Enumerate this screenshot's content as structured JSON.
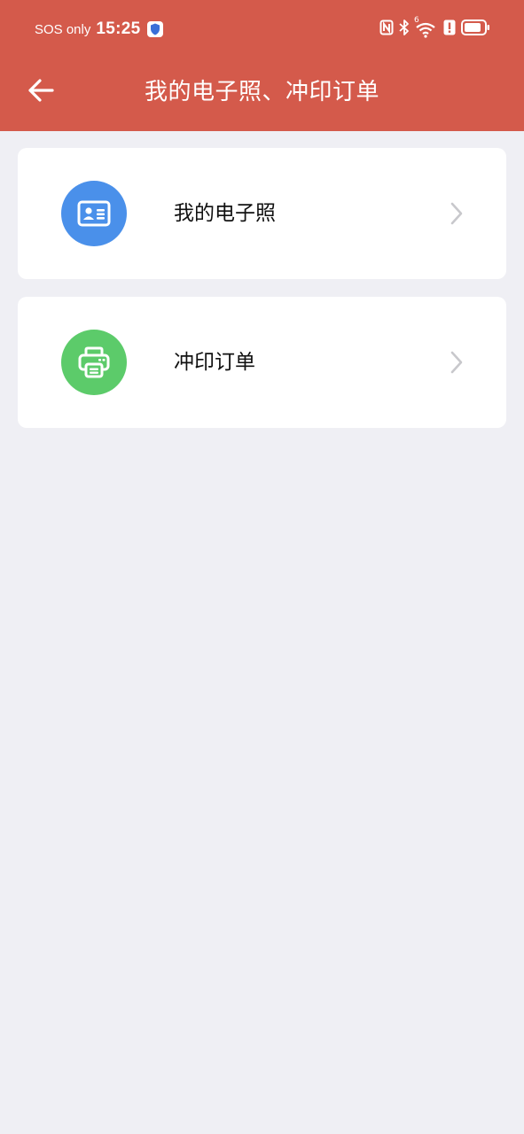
{
  "status_bar": {
    "network": "SOS only",
    "time": "15:25",
    "wifi_badge": "6",
    "icons": [
      "shield-icon",
      "nfc-icon",
      "bluetooth-icon",
      "wifi-icon",
      "alert-icon",
      "battery-icon"
    ]
  },
  "header": {
    "title": "我的电子照、冲印订单",
    "background_color": "#d45a4b",
    "back_icon": "arrow-left-icon"
  },
  "menu": {
    "items": [
      {
        "label": "我的电子照",
        "icon": "id-card-icon",
        "icon_color": "#4a90ea"
      },
      {
        "label": "冲印订单",
        "icon": "printer-icon",
        "icon_color": "#5ccb6a"
      }
    ]
  }
}
